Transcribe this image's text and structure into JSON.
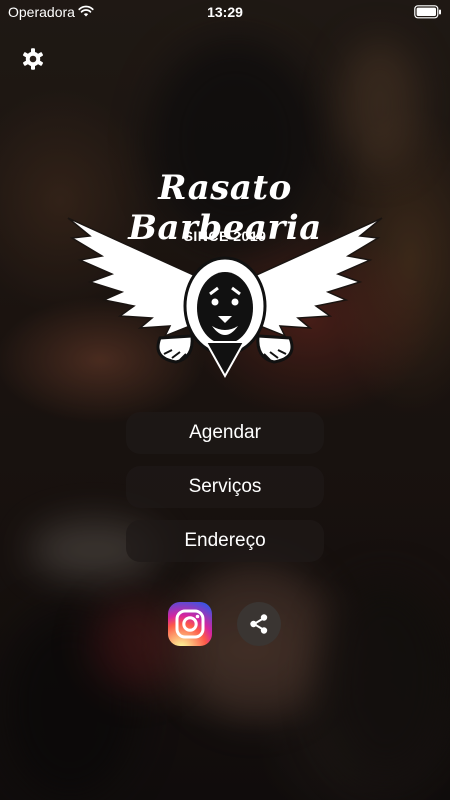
{
  "status_bar": {
    "carrier": "Operadora",
    "time": "13:29",
    "wifi_icon": "wifi-icon",
    "battery_icon": "battery-icon"
  },
  "header": {
    "settings_icon": "gear-icon"
  },
  "logo": {
    "brand": "Rasato Barbearia",
    "since": "SINCE 2019",
    "emblem_icon": "winged-lion-icon"
  },
  "menu": {
    "items": [
      {
        "label": "Agendar"
      },
      {
        "label": "Serviços"
      },
      {
        "label": "Endereço"
      }
    ]
  },
  "social": {
    "instagram_icon": "instagram-icon",
    "share_icon": "share-icon"
  },
  "colors": {
    "text": "#ffffff",
    "button_bg": "#1e1917",
    "share_bg": "#3a3532"
  }
}
